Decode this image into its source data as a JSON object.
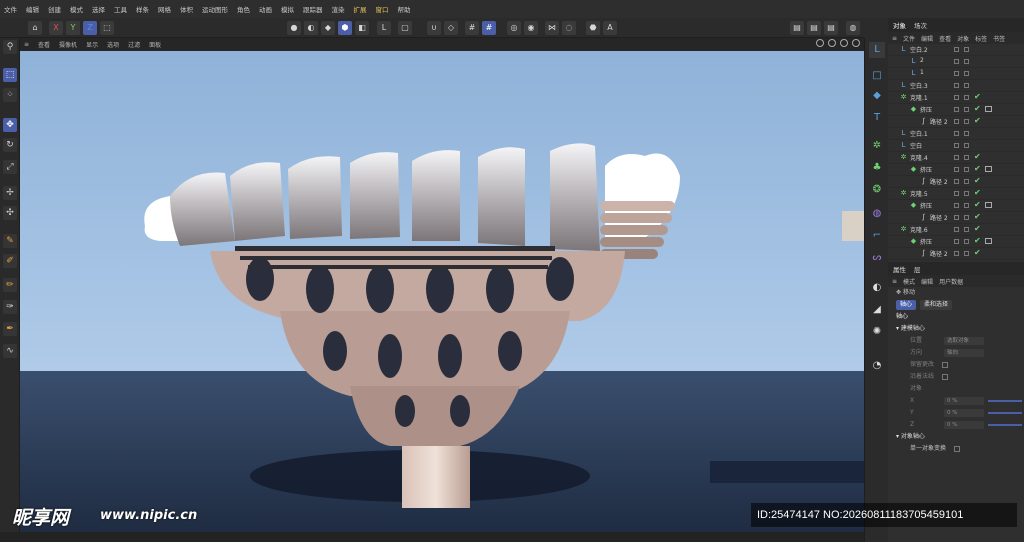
{
  "menubar": {
    "items": [
      "文件",
      "编辑",
      "创建",
      "模式",
      "选择",
      "工具",
      "样条",
      "网格",
      "体积",
      "运动图形",
      "角色",
      "动画",
      "模拟",
      "跟踪器",
      "渲染",
      "扩展",
      "窗口",
      "帮助"
    ]
  },
  "toolbar": {
    "axis_x": "X",
    "axis_y": "Y",
    "axis_z": "Z"
  },
  "viewport": {
    "menu": [
      "查看",
      "摄像机",
      "显示",
      "选项",
      "过滤",
      "面板"
    ]
  },
  "object_manager": {
    "tabs": [
      "对象",
      "场次"
    ],
    "menu": [
      "文件",
      "编辑",
      "查看",
      "对象",
      "标签",
      "书签"
    ],
    "rows": [
      {
        "name": "空白.2",
        "indent": 0,
        "icon": "null",
        "check": false
      },
      {
        "name": "2",
        "indent": 1,
        "icon": "null",
        "check": false
      },
      {
        "name": "1",
        "indent": 1,
        "icon": "null",
        "check": false
      },
      {
        "name": "空白.3",
        "indent": 0,
        "icon": "null",
        "check": false
      },
      {
        "name": "克隆.1",
        "indent": 0,
        "icon": "cloner",
        "check": true
      },
      {
        "name": "挤压",
        "indent": 1,
        "icon": "extrude",
        "check": true
      },
      {
        "name": "路径 2",
        "indent": 2,
        "icon": "spline",
        "check": true
      },
      {
        "name": "空白.1",
        "indent": 0,
        "icon": "null",
        "check": false
      },
      {
        "name": "空白",
        "indent": 0,
        "icon": "null",
        "check": false
      },
      {
        "name": "克隆.4",
        "indent": 0,
        "icon": "cloner",
        "check": true
      },
      {
        "name": "挤压",
        "indent": 1,
        "icon": "extrude",
        "check": true
      },
      {
        "name": "路径 2",
        "indent": 2,
        "icon": "spline",
        "check": true
      },
      {
        "name": "克隆.5",
        "indent": 0,
        "icon": "cloner",
        "check": true
      },
      {
        "name": "挤压",
        "indent": 1,
        "icon": "extrude",
        "check": true
      },
      {
        "name": "路径 2",
        "indent": 2,
        "icon": "spline",
        "check": true
      },
      {
        "name": "克隆.6",
        "indent": 0,
        "icon": "cloner",
        "check": true
      },
      {
        "name": "挤压",
        "indent": 1,
        "icon": "extrude",
        "check": true
      },
      {
        "name": "路径 2",
        "indent": 2,
        "icon": "spline",
        "check": true
      }
    ]
  },
  "attributes": {
    "tabs": [
      "属性",
      "层"
    ],
    "menu": [
      "模式",
      "编辑",
      "用户数据"
    ],
    "tool_name": "移动",
    "subtabs": [
      "轴心",
      "柔和选择"
    ],
    "section": "轴心",
    "group1": "建模轴心",
    "position_label": "位置",
    "position_value": "选取对象",
    "orientation_label": "方向",
    "orientation_value": "轴向",
    "keep_changes": "保留更改",
    "along_normal": "沿着法线",
    "object_label": "对象",
    "x_label": "X",
    "x_value": "0 %",
    "y_label": "Y",
    "y_value": "0 %",
    "z_label": "Z",
    "z_value": "0 %",
    "group2": "对象轴心",
    "single_transform": "单一对象变换"
  },
  "watermark": {
    "logo": "昵享网",
    "url": "www.nipic.cn",
    "id_text": "ID:25474147 NO:20260811183705459101"
  },
  "colors": {
    "accent_blue": "#4a5fa8",
    "check_green": "#6fd06f",
    "menu_highlight": "#e8c35a"
  }
}
